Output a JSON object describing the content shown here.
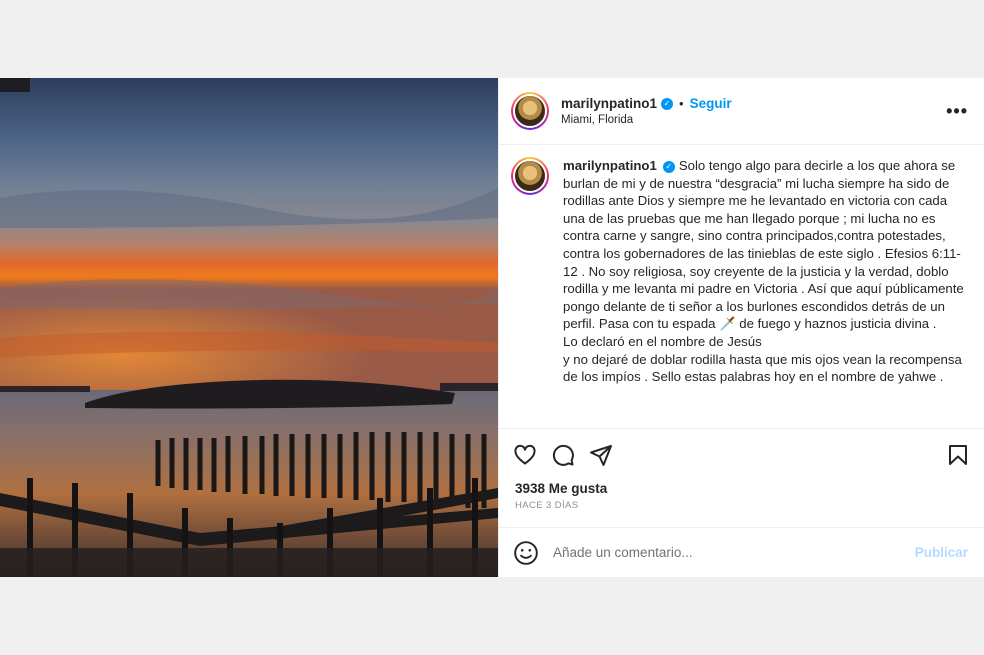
{
  "post": {
    "author": {
      "username": "marilynpatino1",
      "verified_icon": "verified-badge-icon",
      "separator": "•",
      "follow_label": "Seguir",
      "location": "Miami, Florida"
    },
    "more_icon": "more-options-icon",
    "more_label": "•••",
    "caption_text": "Solo tengo algo para decirle a los que ahora se burlan de mi y de nuestra “desgracia” mi lucha siempre ha sido de rodillas ante Dios y siempre me he levantado en victoria con cada una de las pruebas que me han llegado porque ; mi lucha no es contra carne y sangre, sino contra principados,contra potestades, contra los gobernadores de las tinieblas de este siglo . Efesios 6:11-12 . No soy religiosa, soy creyente de la justicia y la verdad, doblo rodilla y me levanta mi padre en Victoria . Así que aquí públicamente pongo delante de ti señor a los burlones escondidos detrás de un perfil. Pasa con tu espada 🗡️ de fuego y haznos justicia divina .\nLo declaró en el nombre de Jesús\ny no dejaré de doblar rodilla hasta que mis ojos vean la recompensa de los impíos . Sello estas palabras hoy en el nombre de yahwe .",
    "actions": {
      "like_icon": "heart-icon",
      "comment_icon": "comment-icon",
      "share_icon": "send-icon",
      "save_icon": "bookmark-icon"
    },
    "likes_label": "3938 Me gusta",
    "time_ago": "HACE 3 DÍAS",
    "comment": {
      "emoji_icon": "emoji-icon",
      "placeholder": "Añade un comentario...",
      "publish_label": "Publicar"
    },
    "colors": {
      "link_blue": "#0095f6",
      "publish_disabled": "#b3dbff",
      "muted": "#8e8e8e"
    }
  }
}
